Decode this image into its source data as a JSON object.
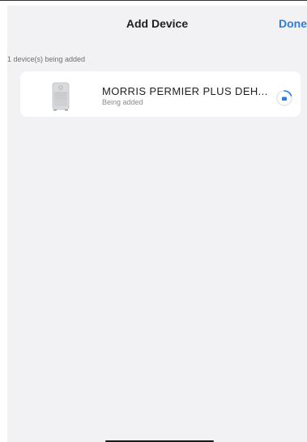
{
  "nav": {
    "title": "Add Device",
    "done_label": "Done"
  },
  "section": {
    "label": "1 device(s) being added"
  },
  "device": {
    "name": "MORRIS PERMIER PLUS DEH...",
    "status": "Being added",
    "image_icon": "dehumidifier-icon",
    "progress_icon": "loading-spinner-icon"
  },
  "colors": {
    "accent": "#2d7ce4",
    "background": "#f2f2f4",
    "card": "#ffffff"
  }
}
